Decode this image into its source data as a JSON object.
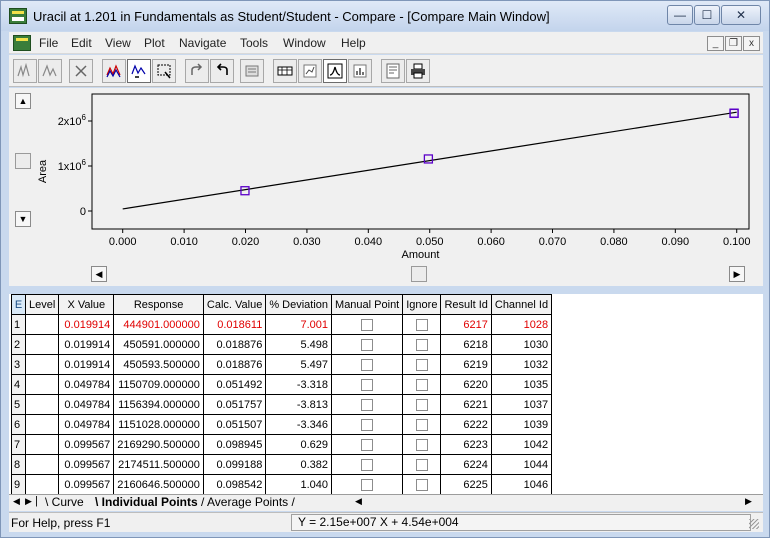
{
  "window": {
    "title": "Uracil at 1.201 in Fundamentals as Student/Student - Compare - [Compare Main Window]",
    "controls": {
      "minimize": "—",
      "maximize": "☐",
      "close": "✕"
    },
    "mdi_controls": {
      "minimize": "_",
      "restore": "❐",
      "close": "x"
    }
  },
  "menu": [
    "File",
    "Edit",
    "View",
    "Plot",
    "Navigate",
    "Tools",
    "Window",
    "Help"
  ],
  "toolbar": {
    "buttons": [
      "peaks-a-icon",
      "peaks-b-icon",
      "close-x-icon",
      "overlay-icon",
      "overlay-select-icon",
      "zoom-box-icon",
      "redo-icon",
      "undo-icon",
      "report-icon",
      "table-icon",
      "chart-small-icon",
      "curve-icon",
      "chart-bars-icon",
      "print-preview-icon",
      "print-icon"
    ],
    "active": [
      "overlay-select-icon",
      "curve-icon"
    ]
  },
  "chart_data": {
    "type": "scatter",
    "title": "",
    "xlabel": "Amount",
    "ylabel": "Area",
    "xlim": [
      -0.005,
      0.102
    ],
    "ylim": [
      -400000,
      2600000
    ],
    "x_ticks": [
      "0.000",
      "0.010",
      "0.020",
      "0.030",
      "0.040",
      "0.050",
      "0.060",
      "0.070",
      "0.080",
      "0.090",
      "0.100"
    ],
    "y_ticks": [
      {
        "value": 0,
        "base": "0",
        "exp": ""
      },
      {
        "value": 1000000,
        "base": "1x10",
        "exp": "6"
      },
      {
        "value": 2000000,
        "base": "2x10",
        "exp": "6"
      }
    ],
    "points": [
      {
        "x": 0.019914,
        "y": 450591
      },
      {
        "x": 0.049784,
        "y": 1156394
      },
      {
        "x": 0.099567,
        "y": 2169290
      },
      {
        "x": 0.099567,
        "y": 2174511
      }
    ],
    "fit": {
      "slope": 21500000,
      "intercept": 45400,
      "x_range": [
        0.0,
        0.1
      ]
    },
    "grid": false,
    "marker_color": "#5b00c8",
    "line_color": "#000000"
  },
  "table": {
    "corner": "E",
    "columns": [
      "Level",
      "X Value",
      "Response",
      "Calc. Value",
      "% Deviation",
      "Manual Point",
      "Ignore",
      "Result Id",
      "Channel Id"
    ],
    "rows": [
      {
        "n": "1",
        "level": "",
        "x": "0.019914",
        "response": "444901.000000",
        "calc": "0.018611",
        "dev": "7.001",
        "result_id": "6217",
        "channel_id": "1028",
        "highlight": true
      },
      {
        "n": "2",
        "level": "",
        "x": "0.019914",
        "response": "450591.000000",
        "calc": "0.018876",
        "dev": "5.498",
        "result_id": "6218",
        "channel_id": "1030",
        "highlight": false
      },
      {
        "n": "3",
        "level": "",
        "x": "0.019914",
        "response": "450593.500000",
        "calc": "0.018876",
        "dev": "5.497",
        "result_id": "6219",
        "channel_id": "1032",
        "highlight": false
      },
      {
        "n": "4",
        "level": "",
        "x": "0.049784",
        "response": "1150709.000000",
        "calc": "0.051492",
        "dev": "-3.318",
        "result_id": "6220",
        "channel_id": "1035",
        "highlight": false
      },
      {
        "n": "5",
        "level": "",
        "x": "0.049784",
        "response": "1156394.000000",
        "calc": "0.051757",
        "dev": "-3.813",
        "result_id": "6221",
        "channel_id": "1037",
        "highlight": false
      },
      {
        "n": "6",
        "level": "",
        "x": "0.049784",
        "response": "1151028.000000",
        "calc": "0.051507",
        "dev": "-3.346",
        "result_id": "6222",
        "channel_id": "1039",
        "highlight": false
      },
      {
        "n": "7",
        "level": "",
        "x": "0.099567",
        "response": "2169290.500000",
        "calc": "0.098945",
        "dev": "0.629",
        "result_id": "6223",
        "channel_id": "1042",
        "highlight": false
      },
      {
        "n": "8",
        "level": "",
        "x": "0.099567",
        "response": "2174511.500000",
        "calc": "0.099188",
        "dev": "0.382",
        "result_id": "6224",
        "channel_id": "1044",
        "highlight": false
      },
      {
        "n": "9",
        "level": "",
        "x": "0.099567",
        "response": "2160646.500000",
        "calc": "0.098542",
        "dev": "1.040",
        "result_id": "6225",
        "channel_id": "1046",
        "highlight": false
      }
    ]
  },
  "tabs": [
    {
      "label": "Curve",
      "active": false
    },
    {
      "label": "Individual Points",
      "active": true
    },
    {
      "label": "Average Points",
      "active": false
    }
  ],
  "status": {
    "help": "For Help, press F1",
    "equation": "Y = 2.15e+007 X + 4.54e+004"
  },
  "colors": {
    "highlight_text": "#e00000",
    "marker": "#5b00c8"
  }
}
